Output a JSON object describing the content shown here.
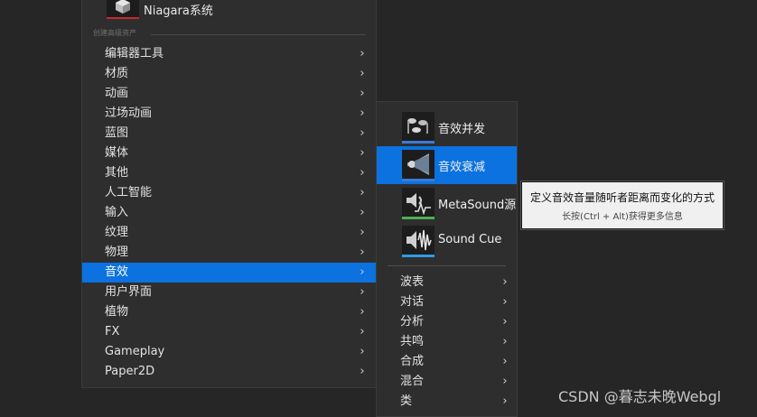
{
  "main_menu": {
    "niagara_label": "Niagara系统",
    "section_title": "创建高级资产",
    "items": [
      {
        "label": "编辑器工具"
      },
      {
        "label": "材质"
      },
      {
        "label": "动画"
      },
      {
        "label": "过场动画"
      },
      {
        "label": "蓝图"
      },
      {
        "label": "媒体"
      },
      {
        "label": "其他"
      },
      {
        "label": "人工智能"
      },
      {
        "label": "输入"
      },
      {
        "label": "纹理"
      },
      {
        "label": "物理"
      },
      {
        "label": "音效",
        "active": true
      },
      {
        "label": "用户界面"
      },
      {
        "label": "植物"
      },
      {
        "label": "FX"
      },
      {
        "label": "Gameplay"
      },
      {
        "label": "Paper2D"
      }
    ],
    "chevron_glyph": "›"
  },
  "audio_submenu": {
    "assets": [
      {
        "label": "音效并发",
        "icon": "concurrency-icon",
        "bar_color": "#3a7bd5"
      },
      {
        "label": "音效衰减",
        "icon": "attenuation-icon",
        "bar_color": "#3a7bd5",
        "active": true
      },
      {
        "label": "MetaSound源",
        "icon": "metasound-icon",
        "bar_color": "#4caf50"
      },
      {
        "label": "Sound Cue",
        "icon": "sound-cue-icon",
        "bar_color": "#2f9be8"
      }
    ],
    "categories": [
      {
        "label": "波表"
      },
      {
        "label": "对话"
      },
      {
        "label": "分析"
      },
      {
        "label": "共鸣"
      },
      {
        "label": "合成"
      },
      {
        "label": "混合"
      },
      {
        "label": "类"
      }
    ]
  },
  "tooltip": {
    "title": "定义音效音量随听者距离而变化的方式",
    "hint": "长按(Ctrl + Alt)获得更多信息"
  },
  "watermark": "CSDN @暮志未晚Webgl",
  "colors": {
    "accent": "#0b72e0",
    "background": "#262626",
    "menu_bg": "#2e2e2e"
  }
}
